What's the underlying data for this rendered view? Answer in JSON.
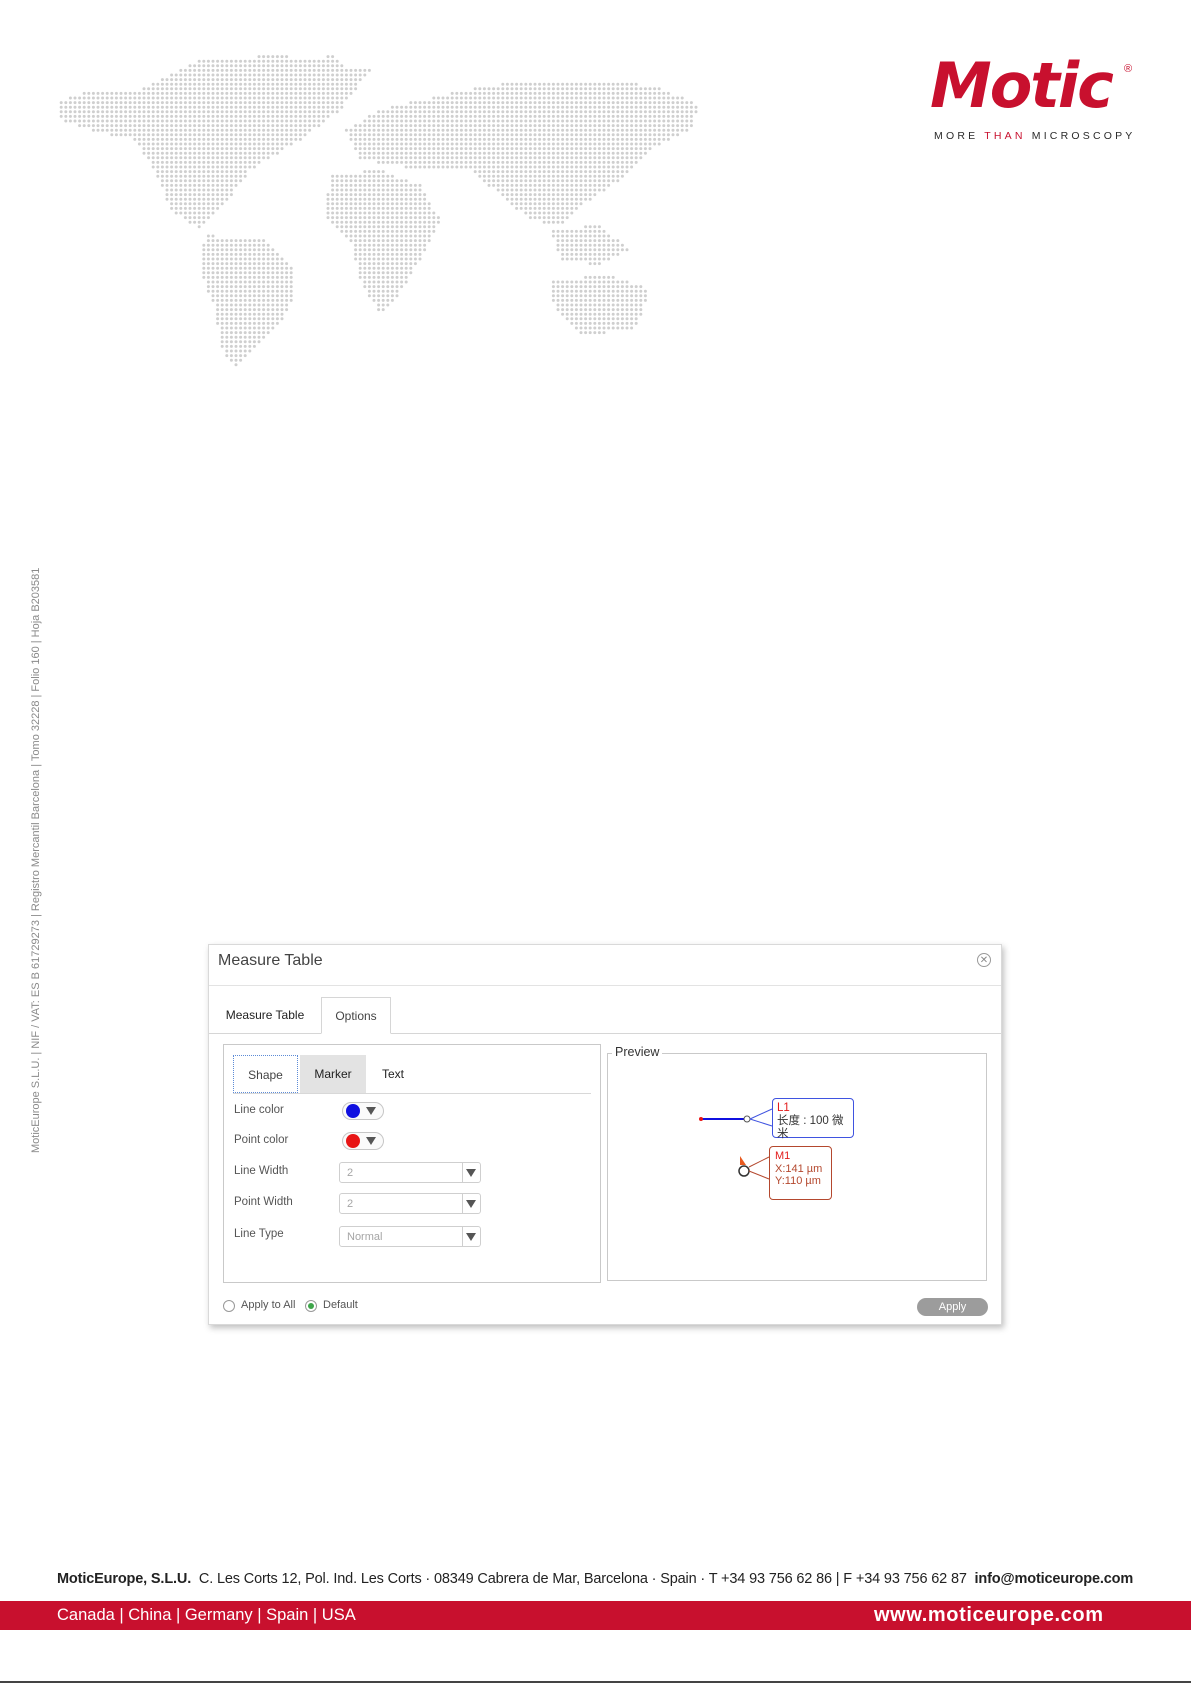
{
  "header": {
    "logo_text": "Motic",
    "logo_registered": "®",
    "tagline_pre": "MORE ",
    "tagline_accent": "THAN",
    "tagline_post": " MICROSCOPY"
  },
  "legal_vertical": "MoticEurope S.L.U. | NIF / VAT: ES B 61729273 | Registro Mercantil Barcelona | Tomo 32228 | Folio 160 | Hoja B203581",
  "dialog": {
    "title": "Measure Table",
    "tabs": [
      "Measure Table",
      "Options"
    ],
    "subtabs": [
      "Shape",
      "Marker",
      "Text"
    ],
    "fields": {
      "line_color_label": "Line color",
      "point_color_label": "Point color",
      "line_width_label": "Line Width",
      "line_width_value": "2",
      "point_width_label": "Point Width",
      "point_width_value": "2",
      "line_type_label": "Line Type",
      "line_type_value": "Normal"
    },
    "colors": {
      "line": "#1010e0",
      "point": "#e81515"
    },
    "preview": {
      "legend": "Preview",
      "l1_name": "L1",
      "l1_text": "长度 : 100 微米",
      "m1_name": "M1",
      "m1_x": "X:141 µm",
      "m1_y": "Y:110 µm"
    },
    "footer": {
      "apply_all_label": "Apply to All",
      "default_label": "Default",
      "apply_button": "Apply"
    }
  },
  "footer": {
    "company": "MoticEurope, S.L.U.",
    "address": "C. Les Corts 12, Pol. Ind. Les Corts · 08349 Cabrera de Mar, Barcelona · Spain · T +34 93 756 62 86 | F +34 93 756 62 87",
    "email": "info@moticeurope.com",
    "countries": "Canada | China | Germany | Spain | USA",
    "website": "www.moticeurope.com"
  },
  "brand_color": "#c8102e"
}
